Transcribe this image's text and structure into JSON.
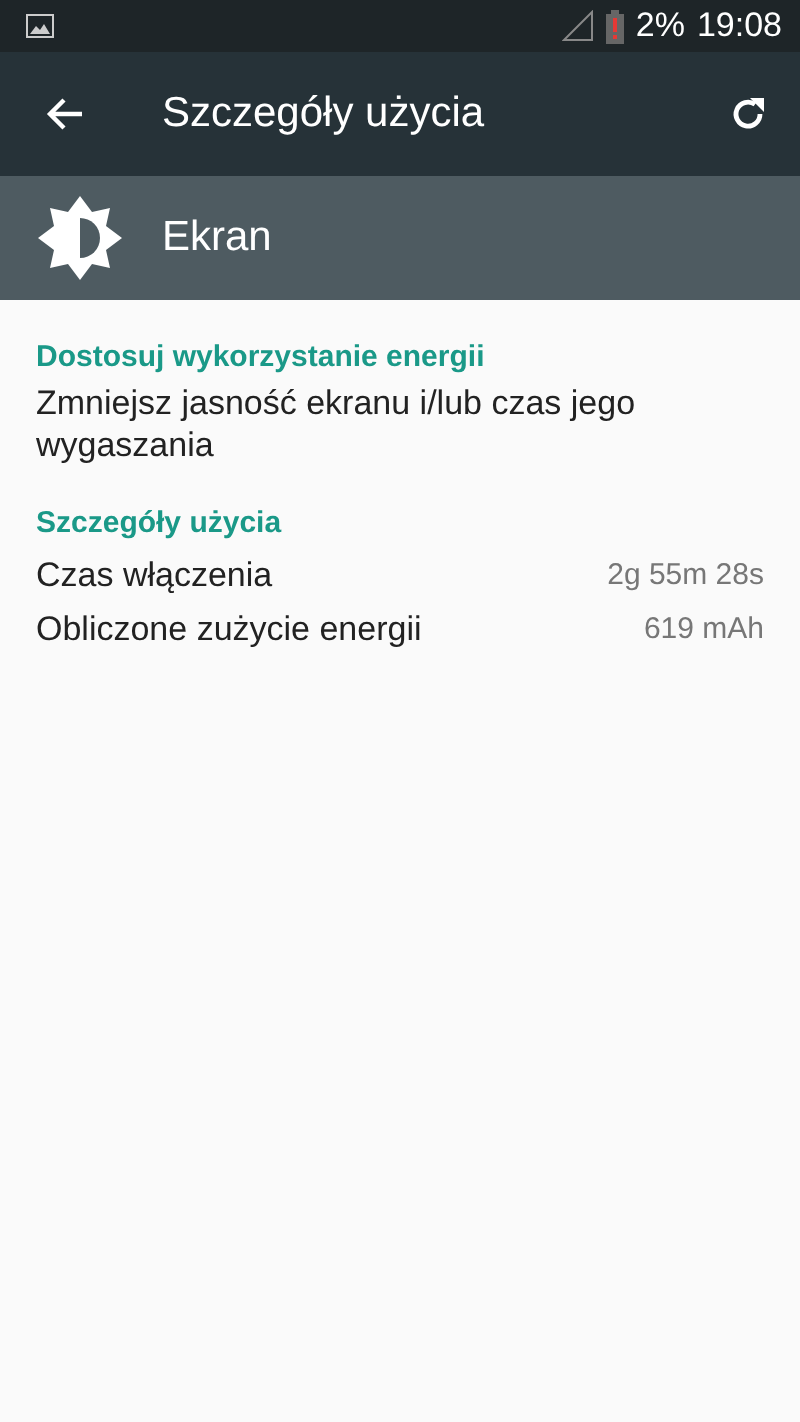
{
  "status_bar": {
    "battery_percent": "2%",
    "time": "19:08"
  },
  "toolbar": {
    "title": "Szczegóły użycia"
  },
  "app_header": {
    "name": "Ekran"
  },
  "sections": [
    {
      "title": "Dostosuj wykorzystanie energii",
      "kind": "text",
      "text": "Zmniejsz jasność ekranu i/lub czas jego wygaszania"
    },
    {
      "title": "Szczegóły użycia",
      "kind": "rows",
      "rows": [
        {
          "label": "Czas włączenia",
          "value": "2g 55m 28s"
        },
        {
          "label": "Obliczone zużycie energii",
          "value": "619 mAh"
        }
      ]
    }
  ]
}
